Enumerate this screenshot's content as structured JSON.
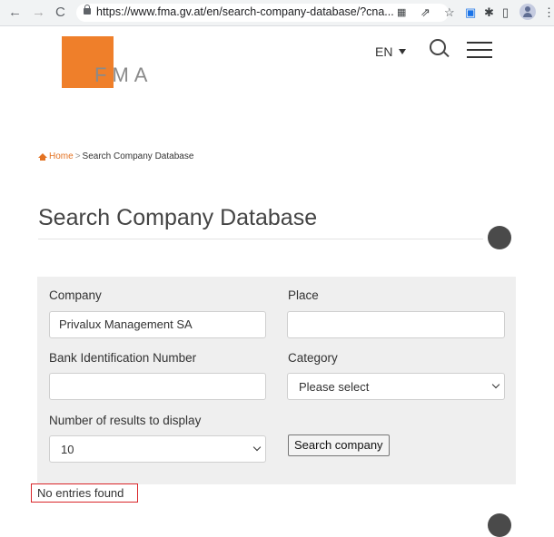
{
  "browser": {
    "back": "←",
    "forward": "→",
    "reload": "C",
    "url_prefix": "https://www.",
    "url_host": "fma.gv.at",
    "url_rest": "/en/search-company-database/?cna..."
  },
  "header": {
    "logo_text": "FMA",
    "language": "EN"
  },
  "breadcrumb": {
    "home": "Home",
    "separator": ">",
    "current": "Search Company Database"
  },
  "page_title": "Search Company Database",
  "form": {
    "company_label": "Company",
    "company_value": "Privalux Management SA",
    "place_label": "Place",
    "place_value": "",
    "bin_label": "Bank Identification Number",
    "bin_value": "",
    "category_label": "Category",
    "category_value": "Please select",
    "results_label": "Number of results to display",
    "results_value": "10",
    "search_button": "Search company"
  },
  "result_message": "No entries found",
  "colors": {
    "brand_orange": "#ef7f2a",
    "highlight_red": "#d9262a",
    "panel_bg": "#efefef"
  }
}
